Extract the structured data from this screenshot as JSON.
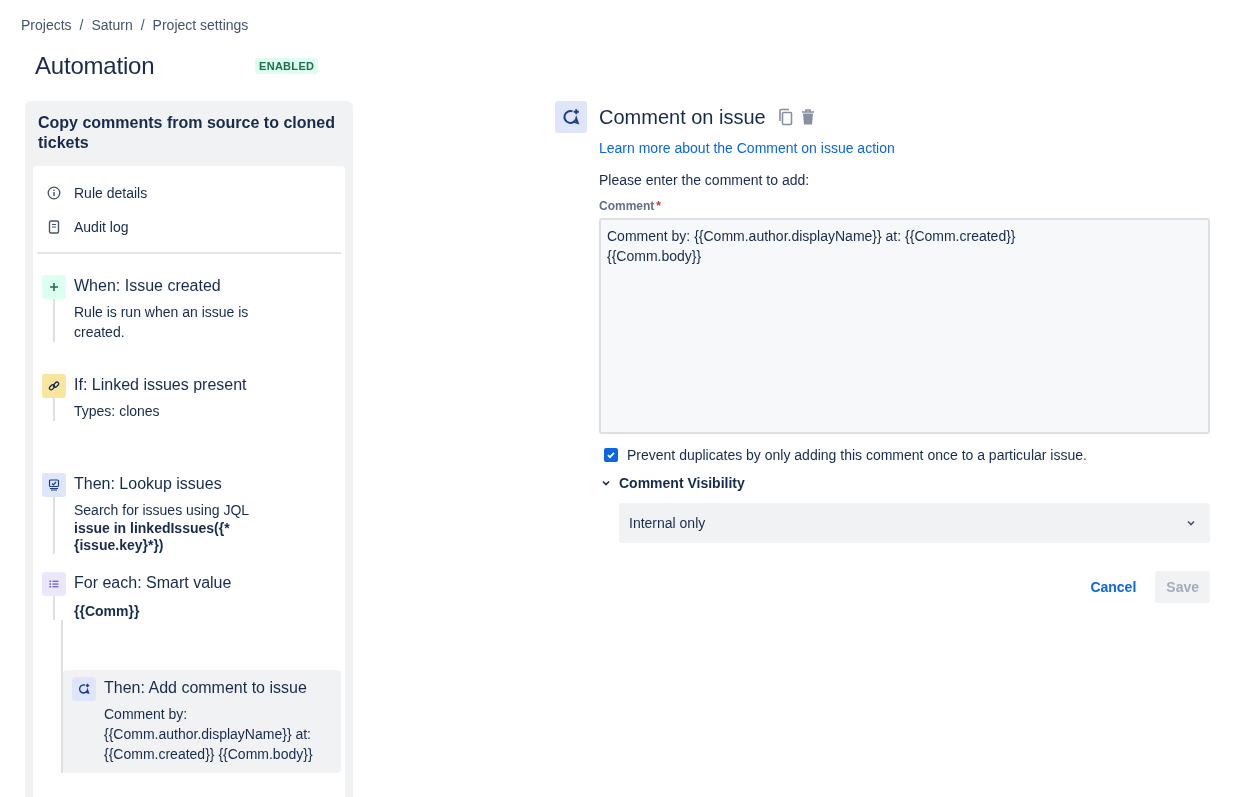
{
  "breadcrumbs": {
    "separator": "/",
    "items": [
      "Projects",
      "Saturn",
      "Project settings"
    ]
  },
  "header": {
    "title": "Automation",
    "status": "ENABLED"
  },
  "rule": {
    "title": "Copy comments from source to cloned tickets",
    "menu": [
      {
        "kind": "info",
        "label": "Rule details"
      },
      {
        "kind": "log",
        "label": "Audit log"
      }
    ],
    "steps": [
      {
        "kind": "trigger",
        "title": "When: Issue created",
        "description": "Rule is run when an issue is created.",
        "selected": false
      },
      {
        "kind": "condition",
        "title": "If: Linked issues present",
        "description": "Types: clones",
        "selected": false
      },
      {
        "kind": "lookup",
        "title": "Then: Lookup issues",
        "description": "Search for issues using JQL",
        "detail": "issue in linkedIssues({*{issue.key}*})",
        "selected": false
      },
      {
        "kind": "branch",
        "title": "For each: Smart value",
        "detail": "{{Comm}}",
        "selected": false,
        "children": [
          {
            "kind": "comment",
            "title": "Then: Add comment to issue",
            "description": "Comment by: {{Comm.author.displayName}} at: {{Comm.created}} {{Comm.body}}",
            "selected": true
          }
        ]
      }
    ]
  },
  "editor": {
    "title": "Comment on issue",
    "link": "Learn more about the Comment on issue action",
    "prompt": "Please enter the comment to add:",
    "field": {
      "label": "Comment",
      "required_mark": "*",
      "value": "Comment by: {{Comm.author.displayName}} at: {{Comm.created}}\n{{Comm.body}}"
    },
    "checkbox": {
      "label": "Prevent duplicates by only adding this comment once to a particular issue.",
      "checked": true
    },
    "visibility": {
      "label": "Comment Visibility",
      "expanded": true,
      "value": "Internal only"
    },
    "buttons": [
      {
        "kind": "link",
        "label": "Cancel",
        "disabled": false
      },
      {
        "kind": "primary",
        "label": "Save",
        "disabled": true
      }
    ]
  }
}
